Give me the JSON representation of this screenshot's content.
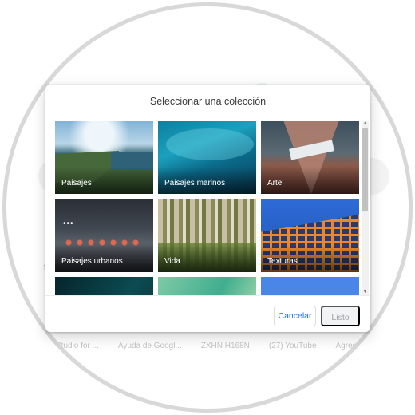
{
  "background": {
    "side_label": "Sc",
    "shortcuts": [
      "Studio for ...",
      "Ayuda de Googl...",
      "ZXHN H168N",
      "(27) YouTube",
      "Agregar un"
    ]
  },
  "dialog": {
    "title": "Seleccionar una colección",
    "collections": [
      {
        "label": "Paisajes",
        "image": "cliff-coast"
      },
      {
        "label": "Paisajes marinos",
        "image": "underwater-sea"
      },
      {
        "label": "Arte",
        "image": "mountain-triangle-art"
      },
      {
        "label": "Paisajes urbanos",
        "image": "city-street-night"
      },
      {
        "label": "Vida",
        "image": "birch-forest"
      },
      {
        "label": "Texturas",
        "image": "building-facade-grid"
      },
      {
        "label": "",
        "image": "partial-teal"
      },
      {
        "label": "",
        "image": "partial-green-polygons"
      },
      {
        "label": "",
        "image": "partial-blue"
      }
    ],
    "buttons": {
      "cancel": "Cancelar",
      "done": "Listo"
    },
    "scroll": {
      "up_icon": "▲",
      "down_icon": "▼"
    }
  },
  "colors": {
    "accent": "#1a73e8",
    "frame": "#d8d8d8",
    "disabled_text": "#a0a4a8"
  }
}
